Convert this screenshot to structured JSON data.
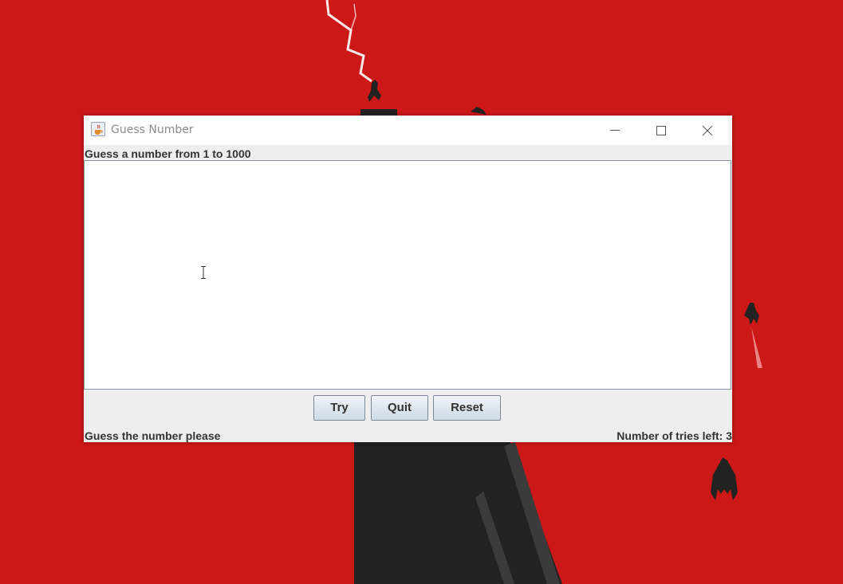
{
  "desktop": {
    "background_color": "#cd1818",
    "scene_dark_color": "#222222"
  },
  "window": {
    "title": "Guess Number",
    "icon": "java-cup-icon",
    "controls": [
      "minimize-icon",
      "maximize-icon",
      "close-icon"
    ]
  },
  "content": {
    "prompt": "Guess a number from 1 to 1000",
    "input_value": ""
  },
  "buttons": {
    "try": "Try",
    "quit": "Quit",
    "reset": "Reset"
  },
  "status": {
    "message": "Guess the number please",
    "tries_left": "Number of tries left: 3"
  }
}
